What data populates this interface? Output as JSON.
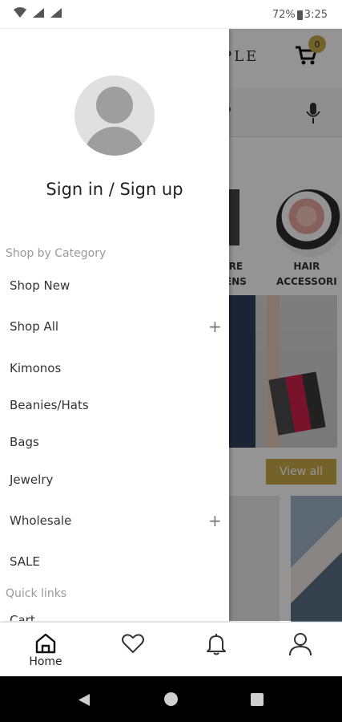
{
  "status_bar": {
    "battery": "72%",
    "time": "3:25"
  },
  "background": {
    "logo_fragment": "IPLE",
    "cart_count": "0",
    "search_fragment": "?",
    "category_left": "RE\nENS",
    "category_right": "HAIR\nACCESSORI",
    "view_all": "View all"
  },
  "drawer": {
    "sign_in": "Sign in / Sign up",
    "shop_by_category": "Shop by Category",
    "items": [
      {
        "label": "Shop New",
        "expand": ""
      },
      {
        "label": "Shop All",
        "expand": "+"
      },
      {
        "label": "Kimonos",
        "expand": ""
      },
      {
        "label": "Beanies/Hats",
        "expand": ""
      },
      {
        "label": "Bags",
        "expand": ""
      },
      {
        "label": "Jewelry",
        "expand": ""
      },
      {
        "label": "Wholesale",
        "expand": "+"
      },
      {
        "label": "SALE",
        "expand": ""
      }
    ],
    "quick_links": "Quick links",
    "quick_links_partial": "Cart"
  },
  "bottom_nav": {
    "home": "Home"
  },
  "colors": {
    "accent": "#c9a94b",
    "scrim": "rgba(0,0,0,0.42)"
  }
}
